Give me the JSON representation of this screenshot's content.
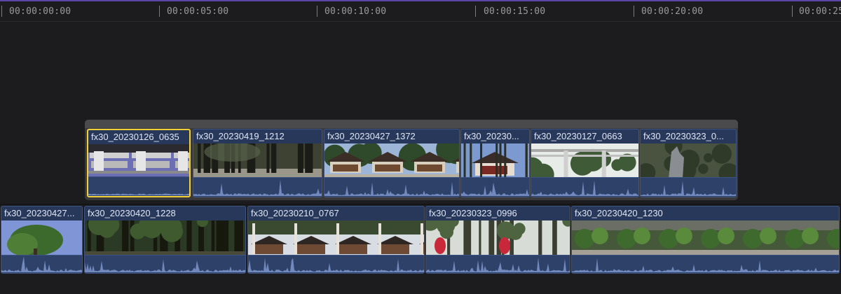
{
  "ruler": {
    "marks": [
      {
        "label": "00:00:00:00"
      },
      {
        "label": "00:00:05:00"
      },
      {
        "label": "00:00:10:00"
      },
      {
        "label": "00:00:15:00"
      },
      {
        "label": "00:00:20:00"
      },
      {
        "label": "00:00:25"
      }
    ]
  },
  "connected_clips": [
    {
      "name": "fx30_20230126_0635",
      "selected": true,
      "scene": "stone-wall"
    },
    {
      "name": "fx30_20230419_1212",
      "selected": false,
      "scene": "forest-path"
    },
    {
      "name": "fx30_20230427_1372",
      "selected": false,
      "scene": "shrine"
    },
    {
      "name": "fx30_20230...",
      "selected": false,
      "scene": "shrine-small"
    },
    {
      "name": "fx30_20230127_0663",
      "selected": false,
      "scene": "torii-white"
    },
    {
      "name": "fx30_20230323_0...",
      "selected": false,
      "scene": "fox-statue"
    }
  ],
  "primary_clips": [
    {
      "name": "fx30_20230427...",
      "scene": "tree-sky"
    },
    {
      "name": "fx30_20230420_1228",
      "scene": "dark-forest"
    },
    {
      "name": "fx30_20230210_0767",
      "scene": "shrine-torii"
    },
    {
      "name": "fx30_20230323_0996",
      "scene": "red-lanterns"
    },
    {
      "name": "fx30_20230420_1230",
      "scene": "garden"
    }
  ],
  "colors": {
    "selection": "#f2d038",
    "clip_body": "#28385a",
    "audio_lane": "#2e4168",
    "waveform": "#7e97cc",
    "background": "#1c1c1e"
  }
}
